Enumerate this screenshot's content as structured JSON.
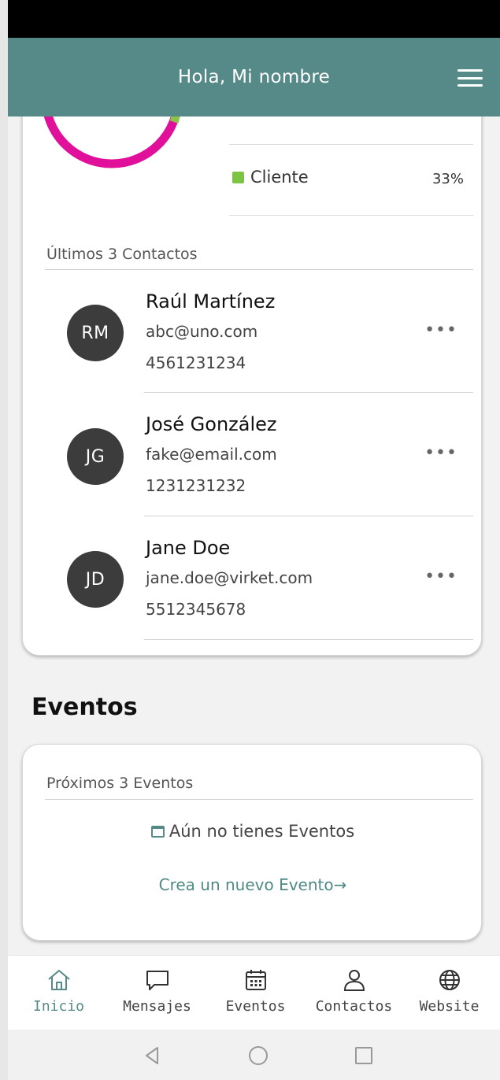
{
  "header": {
    "title": "Hola, Mi nombre",
    "menu_icon": "hamburger-icon"
  },
  "chart_legend": {
    "swatch_color": "#7cc544",
    "label": "Cliente",
    "percent": "33%",
    "donut_colors": [
      "#e0109a",
      "#8bc34a"
    ]
  },
  "contacts": {
    "section_label": "Últimos 3 Contactos",
    "items": [
      {
        "initials": "RM",
        "name": "Raúl Martínez",
        "email": "abc@uno.com",
        "phone": "4561231234",
        "more": "•••"
      },
      {
        "initials": "JG",
        "name": "José González",
        "email": "fake@email.com",
        "phone": "1231231232",
        "more": "•••"
      },
      {
        "initials": "JD",
        "name": "Jane Doe",
        "email": "jane.doe@virket.com",
        "phone": "5512345678",
        "more": "•••"
      }
    ]
  },
  "events": {
    "heading": "Eventos",
    "section_label": "Próximos 3 Eventos",
    "empty_text": "Aún no tienes Eventos",
    "create_link": "Crea un nuevo Evento→"
  },
  "tabs": [
    {
      "label": "Inicio",
      "icon": "home-icon",
      "active": true
    },
    {
      "label": "Mensajes",
      "icon": "chat-bubble-icon",
      "active": false
    },
    {
      "label": "Eventos",
      "icon": "calendar-icon",
      "active": false
    },
    {
      "label": "Contactos",
      "icon": "person-icon",
      "active": false
    },
    {
      "label": "Website",
      "icon": "globe-icon",
      "active": false
    }
  ],
  "colors": {
    "brand": "#568a88",
    "accent_text": "#4f8a86",
    "donut_pink": "#e0109a",
    "donut_green": "#8bc34a"
  }
}
